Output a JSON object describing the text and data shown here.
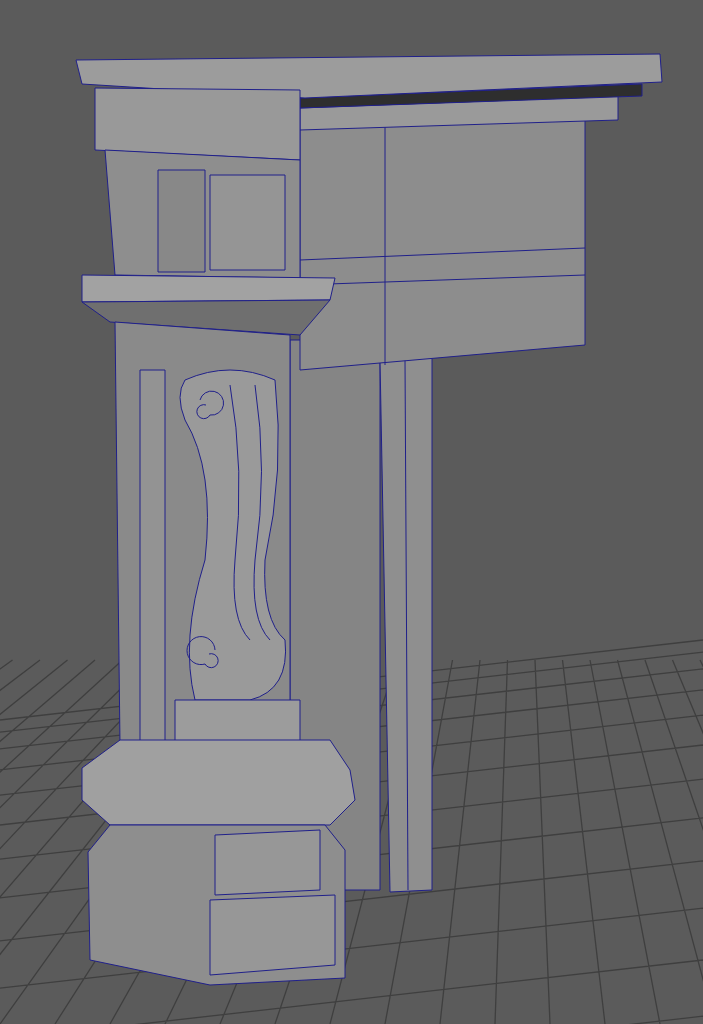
{
  "viewport": {
    "grid_visible": true,
    "wireframe_on_shaded": true
  }
}
